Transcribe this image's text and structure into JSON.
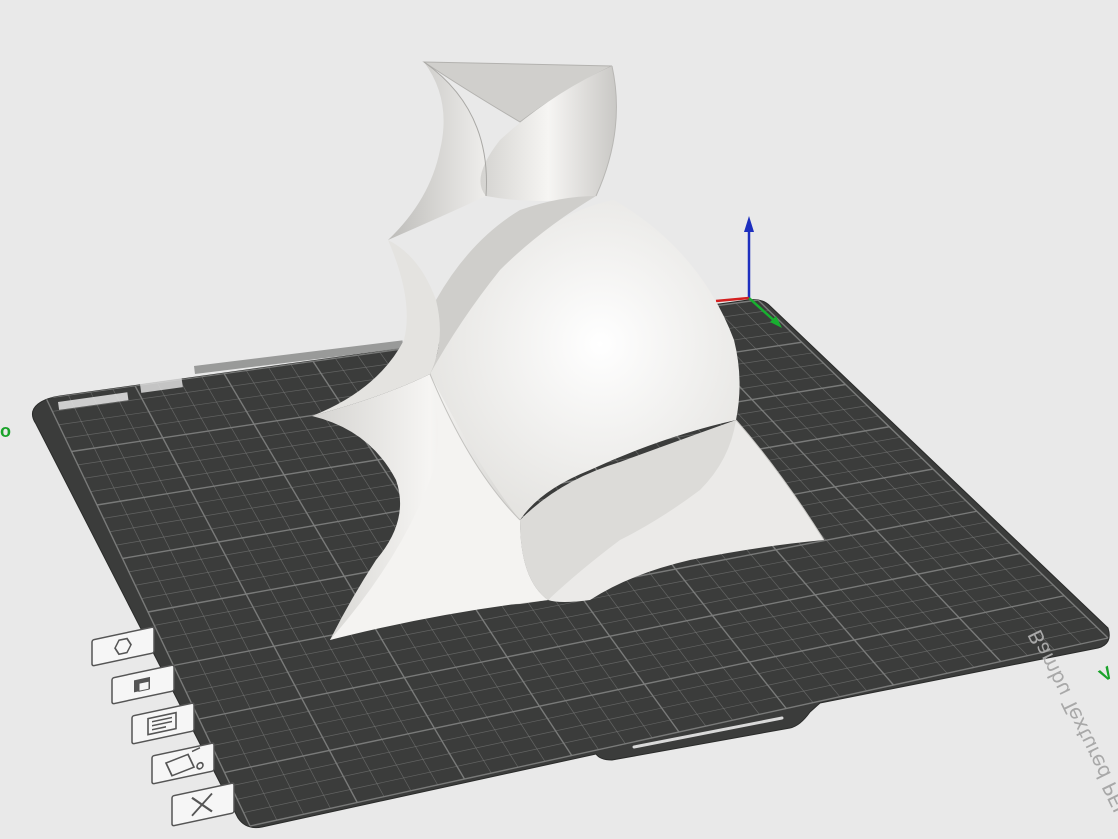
{
  "viewport": {
    "plate": {
      "label": "Bambu Textured PEI Plate",
      "surface_color": "#3b3c3b",
      "grid_color": "#7d7e7d"
    },
    "model": {
      "color": "#f2f1ef"
    },
    "axes": {
      "x_color": "#d42020",
      "y_color": "#18b030",
      "z_color": "#1d2fbf"
    },
    "edge_labels": {
      "left": "o",
      "right": "V"
    },
    "toolbar": {
      "buttons": [
        {
          "icon": "hexagon-icon"
        },
        {
          "icon": "build-plate-icon"
        },
        {
          "icon": "arrange-icon"
        },
        {
          "icon": "plate-settings-icon"
        },
        {
          "icon": "close-icon"
        }
      ]
    }
  }
}
